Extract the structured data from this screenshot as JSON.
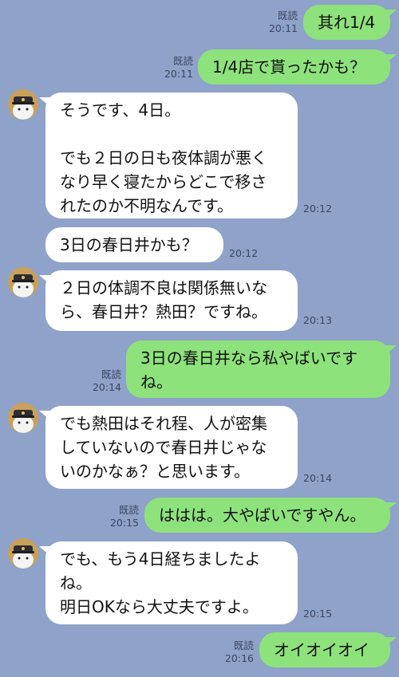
{
  "read_label": "既読",
  "messages": [
    {
      "id": "m1",
      "side": "out",
      "text": "其れ1/4",
      "time": "20:11",
      "read": true
    },
    {
      "id": "m2",
      "side": "out",
      "text": "1/4店で貰ったかも？",
      "time": "20:11",
      "read": true
    },
    {
      "id": "m3",
      "side": "in",
      "text": "そうです、4日。\n\nでも２日の日も夜体調が悪く\nなり早く寝たからどこで移さ\nれたのか不明なんです。",
      "time": "20:12"
    },
    {
      "id": "m4",
      "side": "in",
      "text": "3日の春日井かも？",
      "time": "20:12"
    },
    {
      "id": "m5",
      "side": "in",
      "text": "２日の体調不良は関係無いな\nら、春日井？熱田？ですね。",
      "time": "20:13"
    },
    {
      "id": "m6",
      "side": "out",
      "text": "3日の春日井なら私やばいです\nね。",
      "time": "20:14",
      "read": true
    },
    {
      "id": "m7",
      "side": "in",
      "text": "でも熱田はそれ程、人が密集\nしていないので春日井じゃな\nいのかなぁ？と思います。",
      "time": "20:14"
    },
    {
      "id": "m8",
      "side": "out",
      "text": "ははは。大やばいですやん。",
      "time": "20:15",
      "read": true
    },
    {
      "id": "m9",
      "side": "in",
      "text": "でも、もう4日経ちましたよ\nね。\n明日OKなら大丈夫ですよ。",
      "time": "20:15"
    },
    {
      "id": "m10",
      "side": "out",
      "text": "オイオイオイ",
      "time": "20:16",
      "read": true
    }
  ],
  "colors": {
    "background": "#8fa2c9",
    "outgoing_bubble": "#8de27c",
    "incoming_bubble": "#ffffff"
  },
  "avatar_icon": "captain-cat-avatar-icon"
}
